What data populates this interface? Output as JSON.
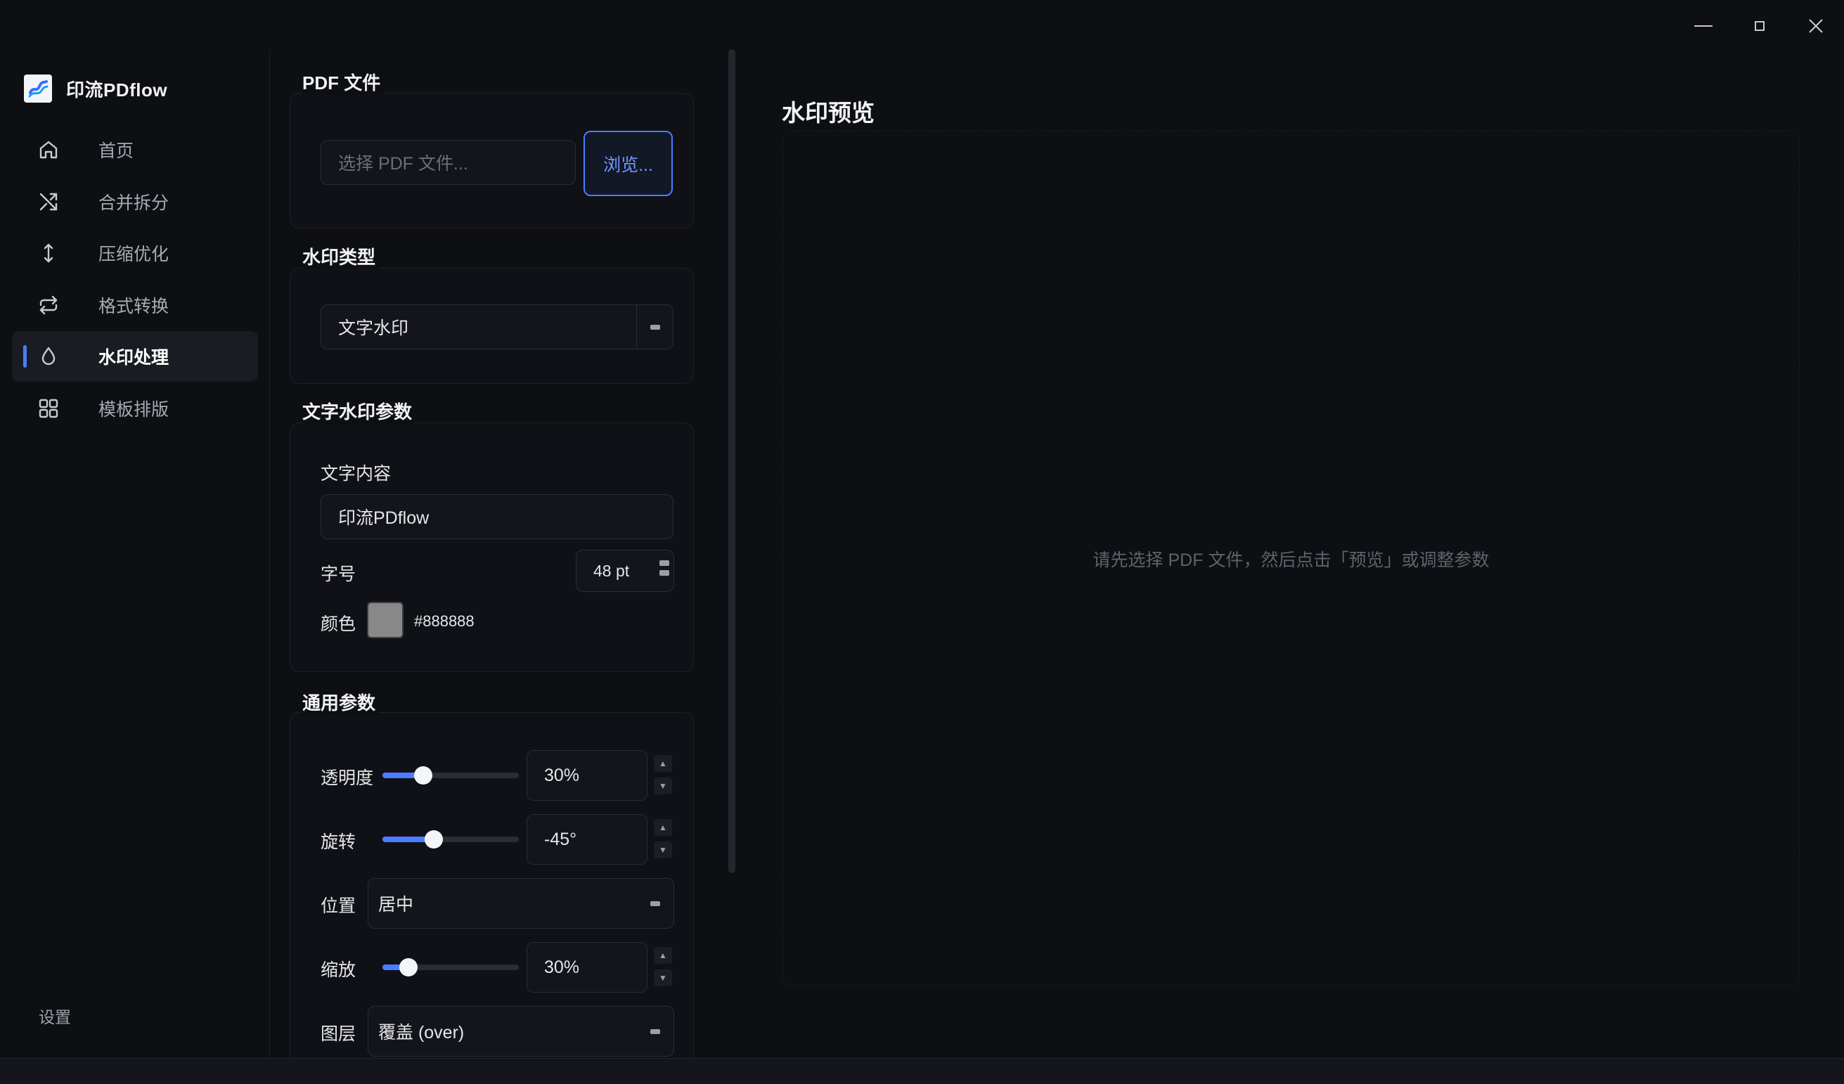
{
  "app": {
    "name": "印流PDflow"
  },
  "sidebar": {
    "items": [
      {
        "label": "首页",
        "icon": "home-icon",
        "active": false
      },
      {
        "label": "合并拆分",
        "icon": "shuffle-icon",
        "active": false
      },
      {
        "label": "压缩优化",
        "icon": "vertical-arrows-icon",
        "active": false
      },
      {
        "label": "格式转换",
        "icon": "repeat-icon",
        "active": false
      },
      {
        "label": "水印处理",
        "icon": "droplet-icon",
        "active": true
      },
      {
        "label": "模板排版",
        "icon": "grid-icon",
        "active": false
      }
    ],
    "settings_label": "设置"
  },
  "pdf_file": {
    "title": "PDF 文件",
    "input_placeholder": "选择 PDF 文件...",
    "browse_label": "浏览..."
  },
  "watermark_type": {
    "title": "水印类型",
    "selected": "文字水印"
  },
  "text_params": {
    "title": "文字水印参数",
    "content_label": "文字内容",
    "content_value": "印流PDflow",
    "size_label": "字号",
    "size_value": "48 pt",
    "color_label": "颜色",
    "color_value": "#888888"
  },
  "general_params": {
    "title": "通用参数",
    "opacity_label": "透明度",
    "opacity_value": "30%",
    "opacity_level": 0.3,
    "rotation_label": "旋转",
    "rotation_value": "-45°",
    "rotation_level": 0.375,
    "position_label": "位置",
    "position_value": "居中",
    "scale_label": "缩放",
    "scale_value": "30%",
    "scale_level": 0.19,
    "layer_label": "图层",
    "layer_value": "覆盖 (over)"
  },
  "preview": {
    "title": "水印预览",
    "hint": "请先选择 PDF 文件，然后点击「预览」或调整参数"
  },
  "colors": {
    "accent": "#4c7dff",
    "background": "#0e0f13",
    "swatch": "#888888"
  }
}
